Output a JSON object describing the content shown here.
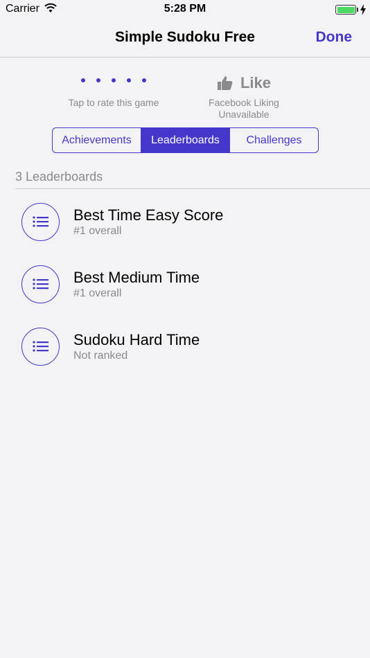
{
  "status_bar": {
    "carrier": "Carrier",
    "time": "5:28 PM",
    "battery_level": 1.0
  },
  "nav": {
    "title": "Simple Sudoku Free",
    "done_label": "Done"
  },
  "rating": {
    "label": "Tap to rate this game"
  },
  "like": {
    "label": "Like",
    "status": "Facebook Liking Unavailable"
  },
  "tabs": [
    {
      "label": "Achievements",
      "active": false
    },
    {
      "label": "Leaderboards",
      "active": true
    },
    {
      "label": "Challenges",
      "active": false
    }
  ],
  "section": {
    "header": "3 Leaderboards"
  },
  "leaderboards": [
    {
      "title": "Best Time Easy Score",
      "rank": "#1 overall"
    },
    {
      "title": "Best Medium Time",
      "rank": "#1 overall"
    },
    {
      "title": "Sudoku Hard Time",
      "rank": "Not ranked"
    }
  ],
  "colors": {
    "accent": "#4338ca",
    "secondary_text": "#8a8a8e",
    "battery": "#4cd964"
  }
}
